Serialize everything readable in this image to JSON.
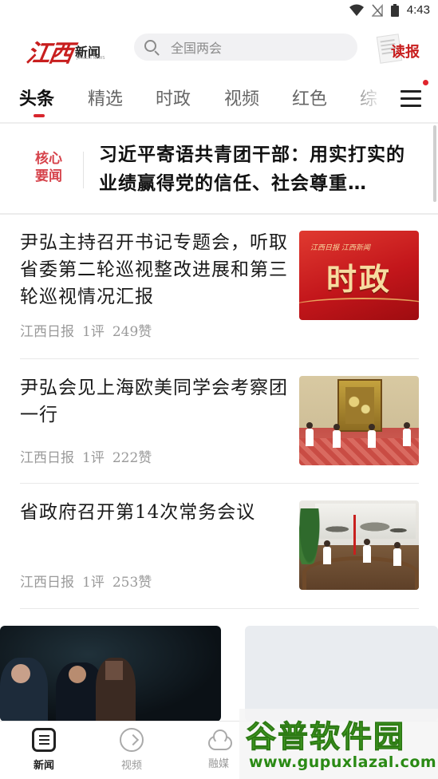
{
  "status_bar": {
    "time": "4:43"
  },
  "header": {
    "logo_script": "江西",
    "logo_name": "新闻",
    "logo_sub": "JIANGXI NEWS",
    "search_placeholder": "全国两会",
    "read_paper_label": "读报"
  },
  "tabs": [
    {
      "label": "头条",
      "active": true
    },
    {
      "label": "精选"
    },
    {
      "label": "时政"
    },
    {
      "label": "视频"
    },
    {
      "label": "红色"
    },
    {
      "label": "综"
    }
  ],
  "core_news": {
    "badge_line1": "核心",
    "badge_line2": "要闻",
    "title": "习近平寄语共青团干部：用实打实的业绩赢得党的信任、社会尊重…"
  },
  "news": [
    {
      "title": "尹弘主持召开书记专题会，听取省委第二轮巡视整改进展和第三轮巡视情况汇报",
      "source": "江西日报",
      "comments": "1评",
      "likes": "249赞",
      "thumb": {
        "mini_text": "江西日报  江西新闻",
        "big_text": "时政"
      }
    },
    {
      "title": "尹弘会见上海欧美同学会考察团一行",
      "source": "江西日报",
      "comments": "1评",
      "likes": "222赞"
    },
    {
      "title": "省政府召开第14次常务会议",
      "source": "江西日报",
      "comments": "1评",
      "likes": "253赞"
    }
  ],
  "bottom_nav": [
    {
      "label": "新闻",
      "active": true,
      "icon": "news-icon"
    },
    {
      "label": "视频",
      "icon": "video-icon"
    },
    {
      "label": "融媒",
      "icon": "cloud-icon"
    }
  ],
  "watermark": {
    "main": "谷普软件园",
    "url": "www.gupuxlazal.com"
  },
  "colors": {
    "accent": "#d8262d",
    "watermark_green": "#4caf2a"
  }
}
